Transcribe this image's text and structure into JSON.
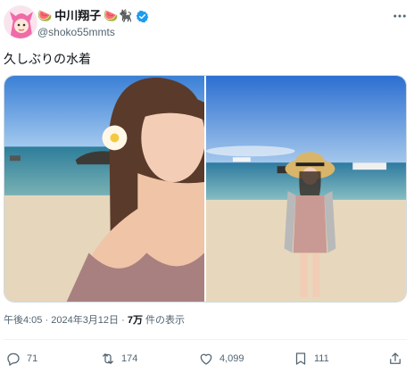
{
  "user": {
    "display_name_prefix": "🍉",
    "display_name": "中川翔子",
    "display_name_suffix": "🍉🐈‍⬛",
    "handle": "@shoko55mmts",
    "verified": true
  },
  "tweet": {
    "text": "久しぶりの水着",
    "time": "午後4:05",
    "separator": "·",
    "date": "2024年3月12日",
    "views_count": "7万",
    "views_label": "件の表示"
  },
  "actions": {
    "reply_count": "71",
    "retweet_count": "174",
    "like_count": "4,099",
    "bookmark_count": "111"
  },
  "icons": {
    "more": "more-dots-icon",
    "reply": "reply-bubble-icon",
    "retweet": "retweet-arrows-icon",
    "like": "heart-icon",
    "bookmark": "bookmark-icon",
    "share": "share-upload-icon",
    "verified": "verified-badge-icon"
  },
  "colors": {
    "text": "#0f1419",
    "secondary": "#536471",
    "verified": "#1d9bf0",
    "border": "#cfd9de"
  }
}
